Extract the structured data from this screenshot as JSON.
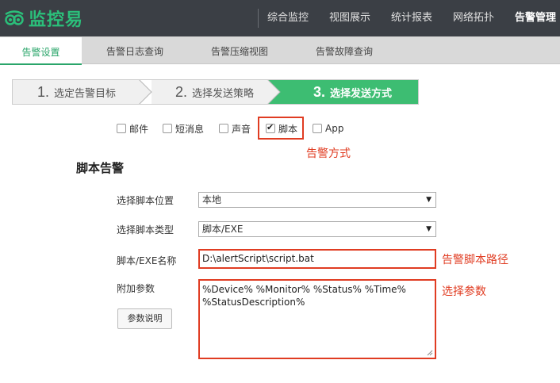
{
  "app": {
    "title": "监控易"
  },
  "nav": {
    "items": [
      "综合监控",
      "视图展示",
      "统计报表",
      "网络拓扑",
      "告警管理"
    ],
    "active": "告警管理"
  },
  "subnav": {
    "tabs": [
      "告警设置",
      "告警日志查询",
      "告警压缩视图",
      "告警故障查询"
    ],
    "active": "告警设置"
  },
  "steps": [
    {
      "num": "1.",
      "label": "选定告警目标"
    },
    {
      "num": "2.",
      "label": "选择发送策略"
    },
    {
      "num": "3.",
      "label": "选择发送方式"
    }
  ],
  "methods": [
    {
      "label": "邮件",
      "checked": false
    },
    {
      "label": "短消息",
      "checked": false
    },
    {
      "label": "声音",
      "checked": false
    },
    {
      "label": "脚本",
      "checked": true
    },
    {
      "label": "App",
      "checked": false
    }
  ],
  "annotations": {
    "method": "告警方式",
    "path": "告警脚本路径",
    "params": "选择参数"
  },
  "section": {
    "title": "脚本告警"
  },
  "form": {
    "location_label": "选择脚本位置",
    "location_value": "本地",
    "type_label": "选择脚本类型",
    "type_value": "脚本/EXE",
    "name_label": "脚本/EXE名称",
    "name_value": "D:\\alertScript\\script.bat",
    "params_label": "附加参数",
    "params_value": "%Device% %Monitor% %Status% %Time% %StatusDescription%",
    "params_button": "参数说明"
  },
  "colors": {
    "accent": "#2aa56a",
    "step_active": "#3dbd72",
    "highlight": "#e03c22",
    "topbar": "#3b3f45"
  }
}
